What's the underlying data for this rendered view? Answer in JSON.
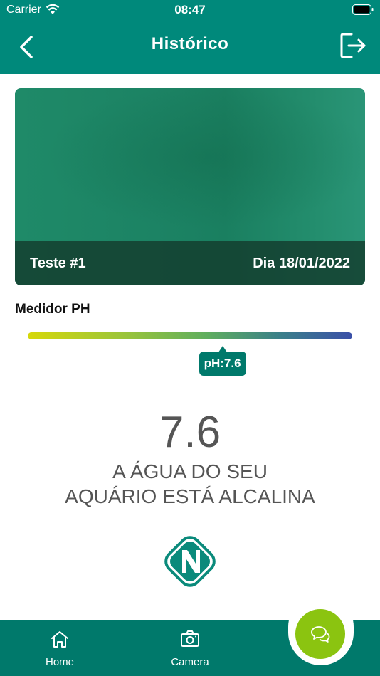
{
  "status_bar": {
    "carrier": "Carrier",
    "time": "08:47"
  },
  "header": {
    "title": "Histórico"
  },
  "photo": {
    "test_label": "Teste #1",
    "date": "Dia 18/01/2022"
  },
  "meter": {
    "title": "Medidor PH",
    "badge": "pH:7.6",
    "level_fraction": 0.6
  },
  "result": {
    "value": "7.6",
    "line1": "A ÁGUA DO SEU",
    "line2": "AQUÁRIO ESTÁ ALCALINA"
  },
  "tabs": [
    {
      "label": "Home",
      "icon": "home-icon"
    },
    {
      "label": "Camera",
      "icon": "camera-icon"
    }
  ],
  "fab": {
    "icon": "chat-icon",
    "color": "#8bc410"
  },
  "colors": {
    "primary": "#00897b",
    "primary_dark": "#00796b",
    "accent": "#8bc410"
  }
}
